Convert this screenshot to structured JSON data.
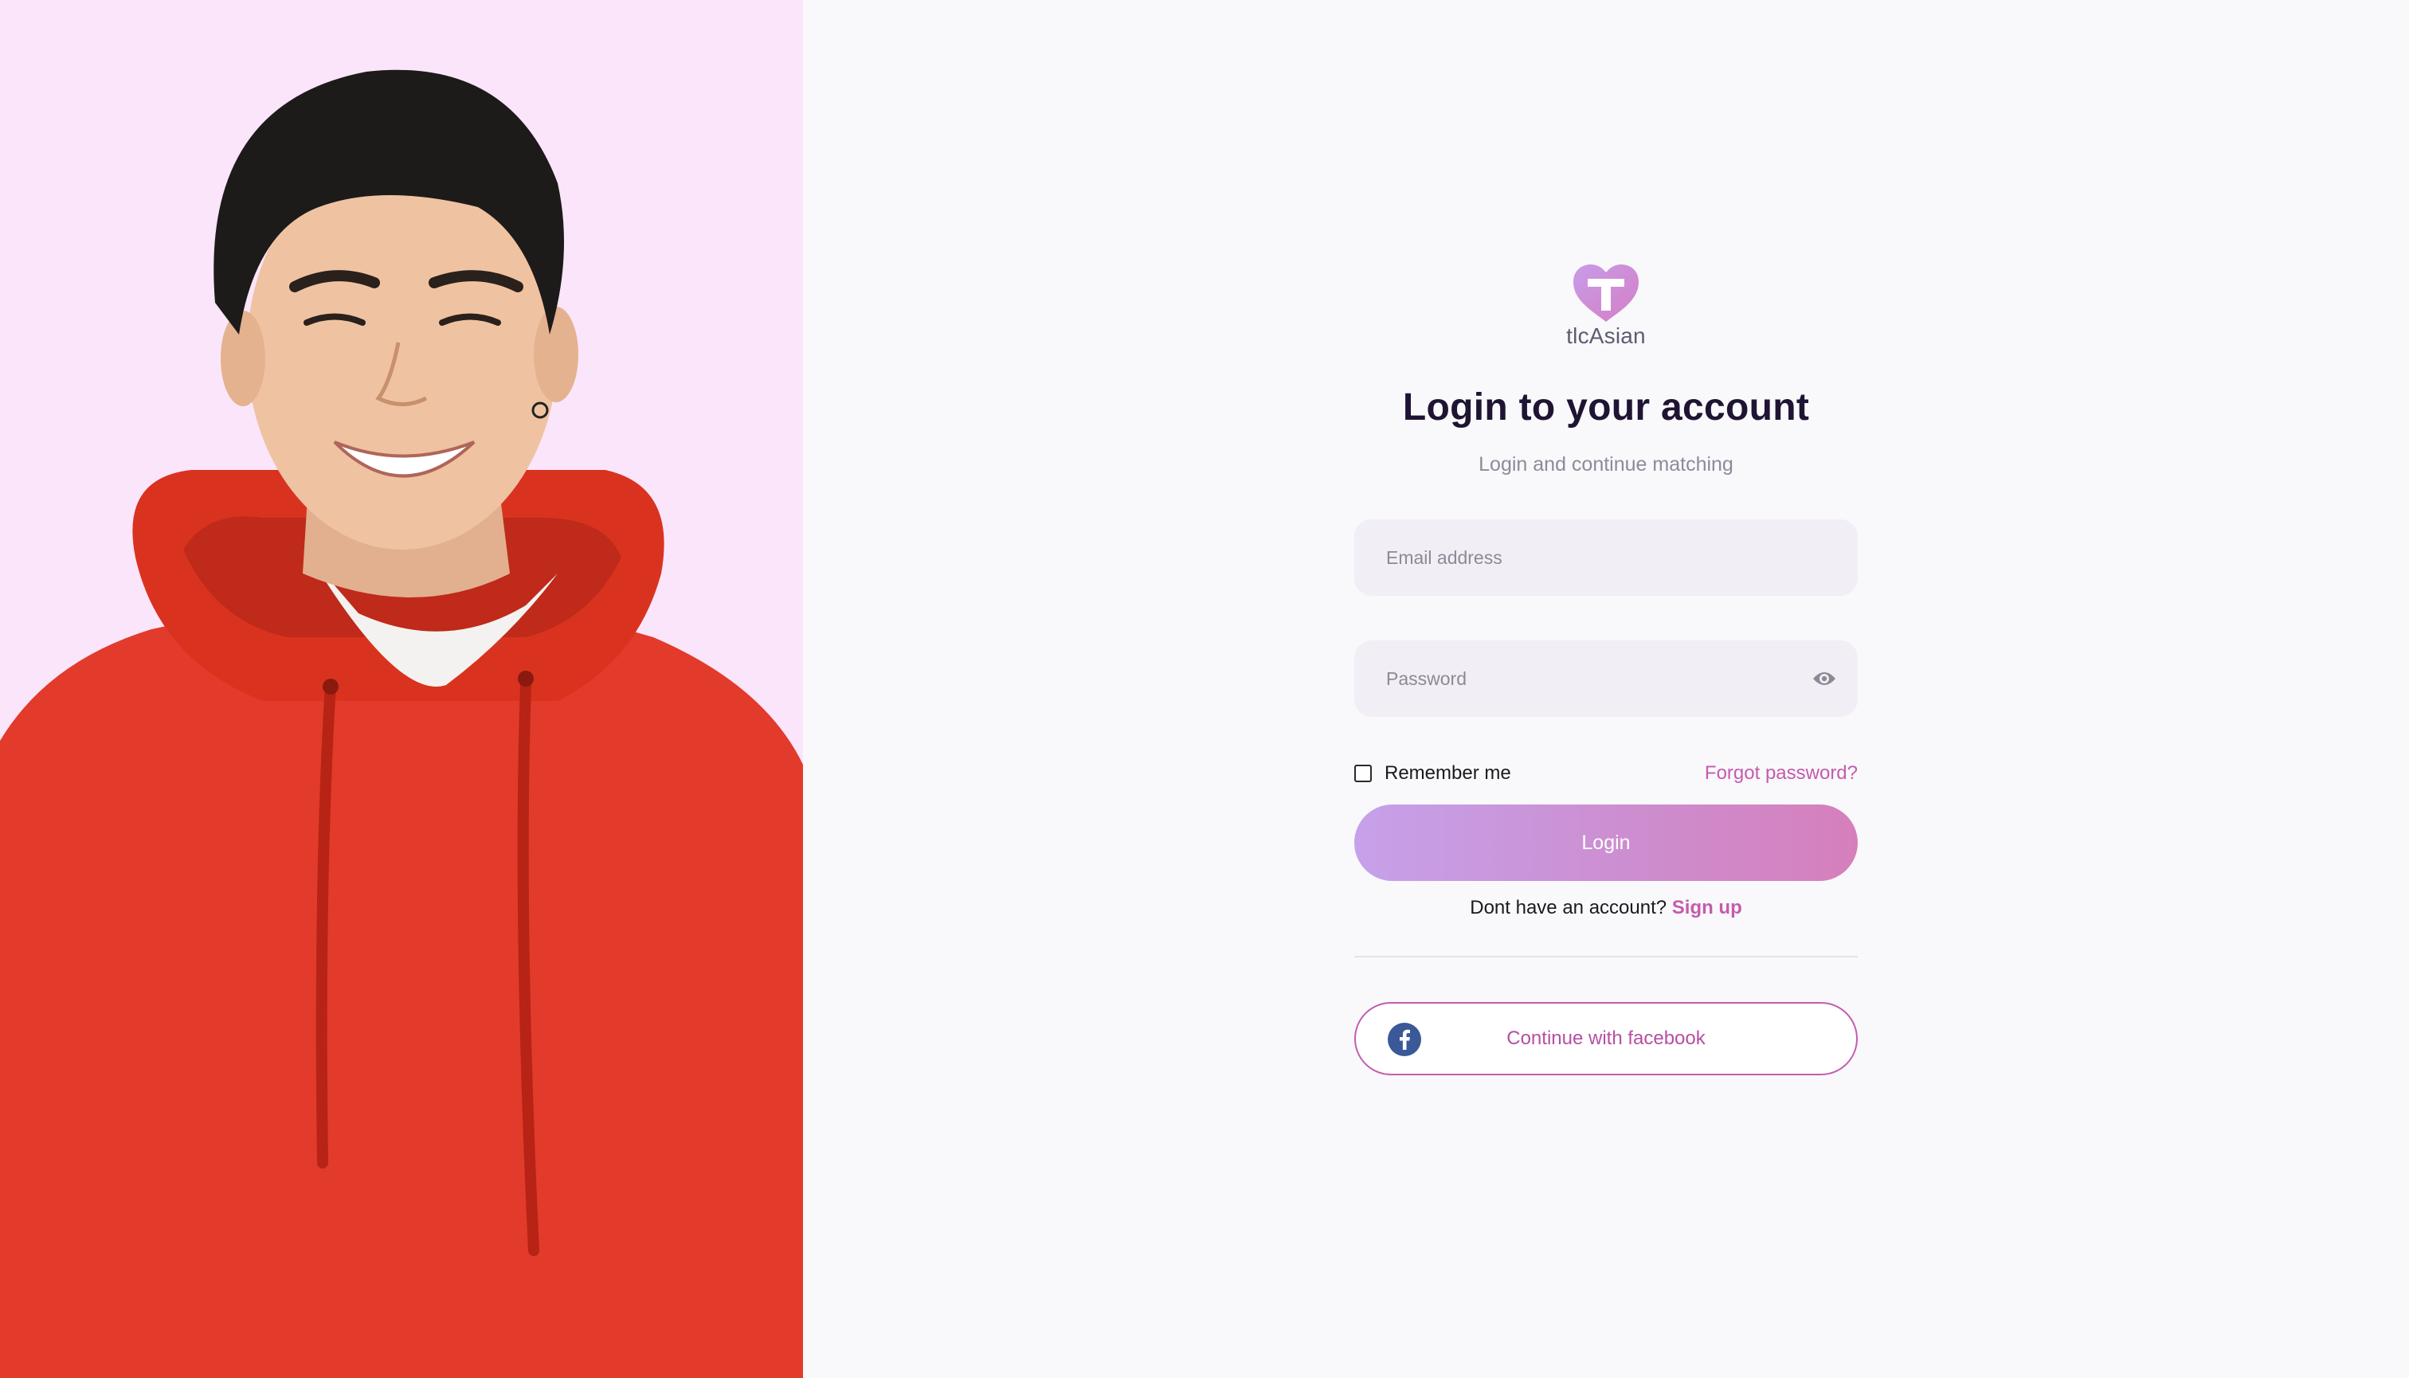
{
  "hero": {
    "image_alt": "Smiling young man in a red hoodie"
  },
  "brand": {
    "name": "tlcAsian",
    "accent_color": "#c35cae",
    "logo_icon": "heart-t-logo-icon"
  },
  "login": {
    "title": "Login to your account",
    "subtitle": "Login and continue matching",
    "email_placeholder": "Email address",
    "password_placeholder": "Password",
    "password_toggle_icon": "eye-icon",
    "remember_label": "Remember me",
    "forgot_label": "Forgot password?",
    "submit_label": "Login",
    "signup_prompt": "Dont have an account?",
    "signup_label": "Sign up",
    "facebook_label": "Continue with facebook",
    "facebook_icon": "facebook-icon"
  }
}
